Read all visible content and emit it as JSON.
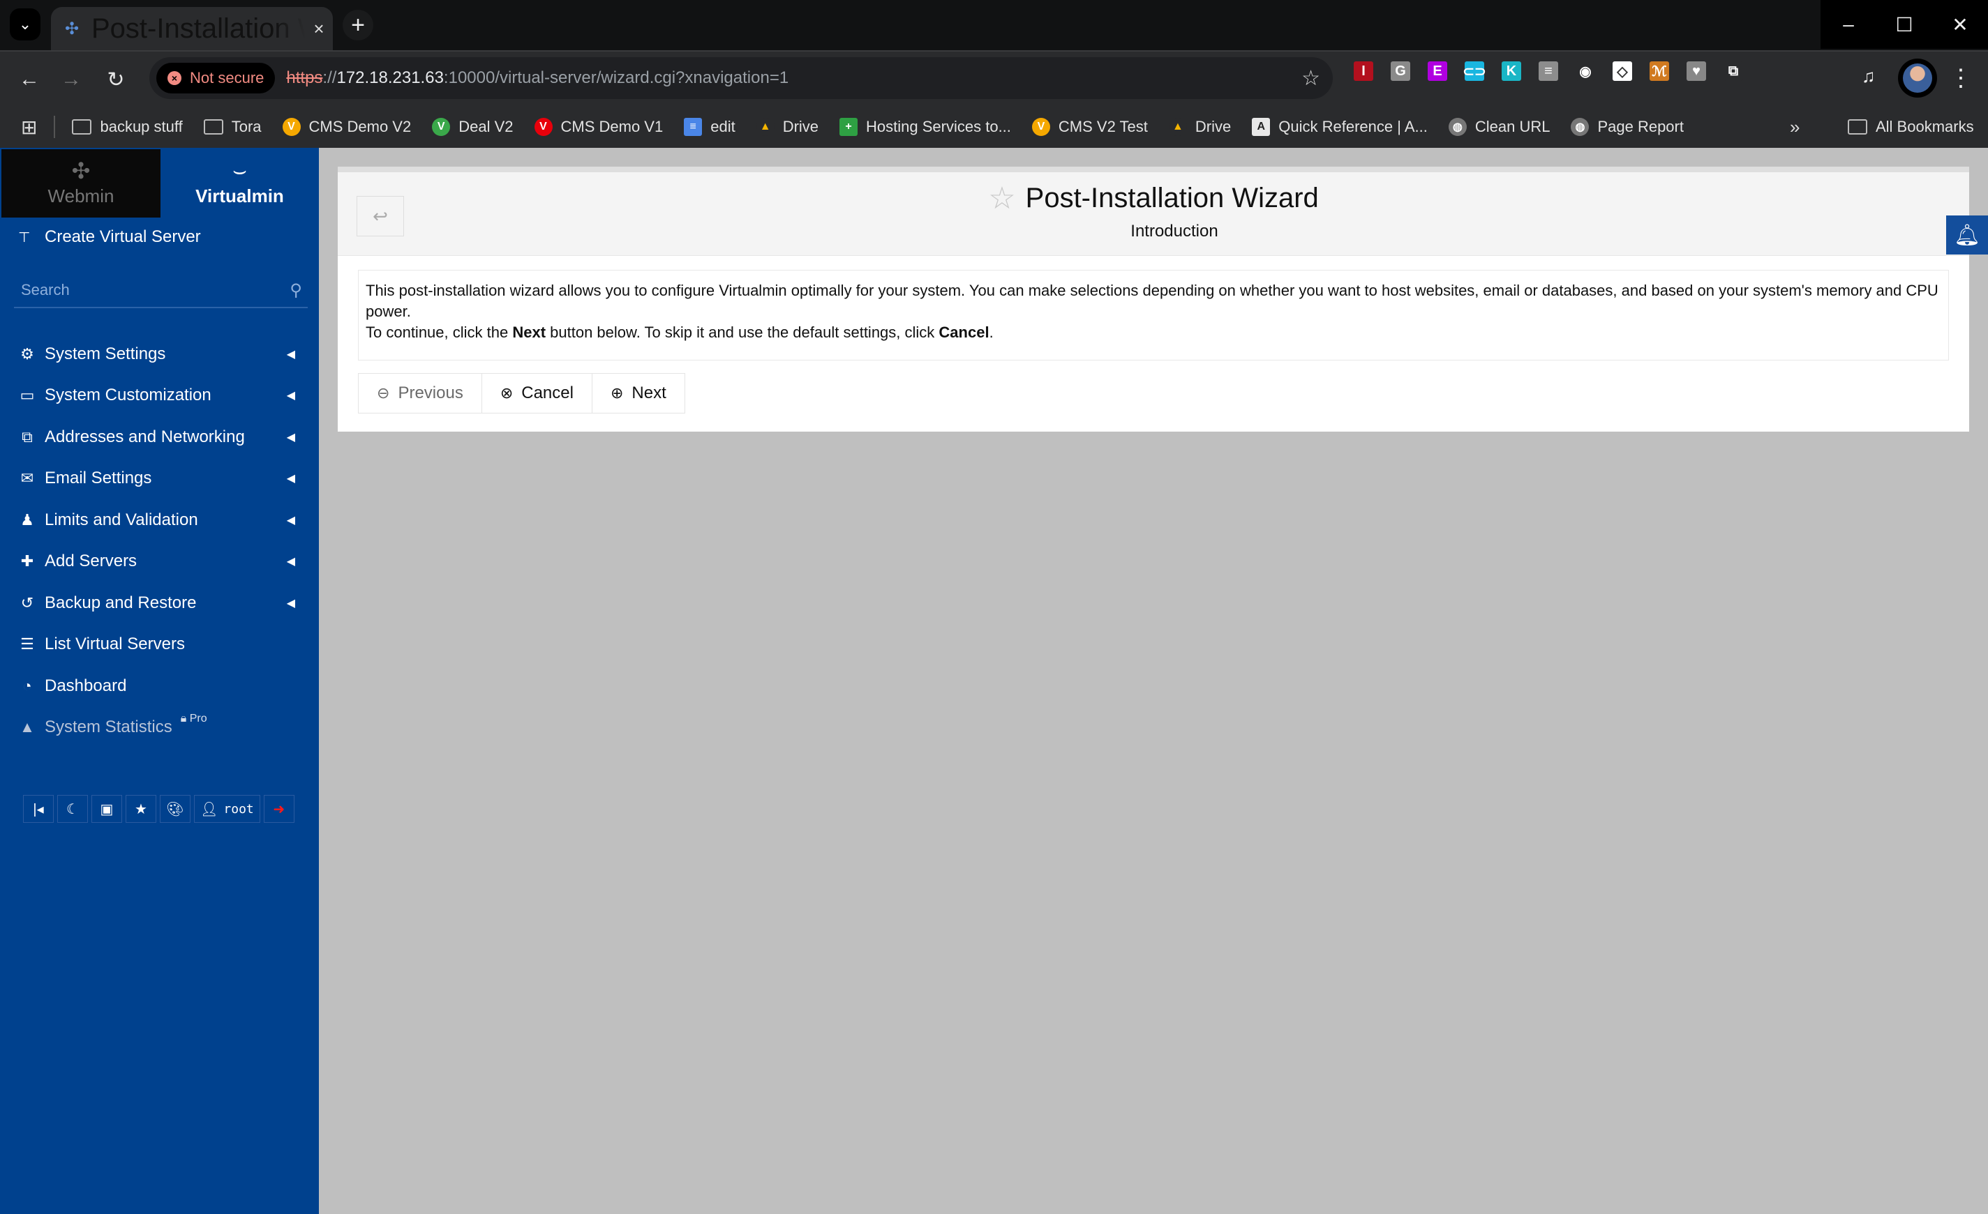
{
  "browser": {
    "tab_title": "Post-Installation Wizard — Webmin",
    "security_chip": "Not secure",
    "url": {
      "scheme": "https",
      "sep": "://",
      "host": "172.18.231.63",
      "rest": ":10000/virtual-server/wizard.cgi?xnavigation=1"
    },
    "extensions": [
      {
        "name": "ext-red-i",
        "glyph": "I",
        "color": "#b3101e"
      },
      {
        "name": "ext-grey-g",
        "glyph": "G",
        "color": "#8a8a8a"
      },
      {
        "name": "ext-purple-e",
        "glyph": "E",
        "color": "#b000e0"
      },
      {
        "name": "ext-link",
        "glyph": "⊂⊃",
        "color": "#19b6e0"
      },
      {
        "name": "ext-tk",
        "glyph": "K",
        "color": "#1ab6c6"
      },
      {
        "name": "ext-db",
        "glyph": "≡",
        "color": "#8d8d8d"
      },
      {
        "name": "ext-chrome",
        "glyph": "◉",
        "color": "#2a2b2d"
      },
      {
        "name": "ext-diamond",
        "glyph": "◇",
        "color": "#ffffff"
      },
      {
        "name": "ext-camel",
        "glyph": "ℳ",
        "color": "#d07a20"
      },
      {
        "name": "ext-heart",
        "glyph": "♥",
        "color": "#888888"
      },
      {
        "name": "ext-puzzle",
        "glyph": "⧉",
        "color": "#2a2b2d"
      }
    ],
    "bookmarks": [
      {
        "label": "backup stuff",
        "icon": "folder"
      },
      {
        "label": "Tora",
        "icon": "folder"
      },
      {
        "label": "CMS Demo V2",
        "icon": "V",
        "color": "#f5a800"
      },
      {
        "label": "Deal V2",
        "icon": "V",
        "color": "#3aa84a"
      },
      {
        "label": "CMS Demo V1",
        "icon": "V",
        "color": "#e8000b"
      },
      {
        "label": "edit",
        "icon": "≡",
        "color": "#4a86e8"
      },
      {
        "label": "Drive",
        "icon": "▲",
        "color": "#2a2b2d"
      },
      {
        "label": "Hosting Services to...",
        "icon": "+",
        "color": "#2ea043"
      },
      {
        "label": "CMS V2 Test",
        "icon": "V",
        "color": "#f5a800"
      },
      {
        "label": "Drive",
        "icon": "▲",
        "color": "#2a2b2d"
      },
      {
        "label": "Quick Reference | A...",
        "icon": "A",
        "color": "#e8e8e8"
      },
      {
        "label": "Clean URL",
        "icon": "globe",
        "color": "#777"
      },
      {
        "label": "Page Report",
        "icon": "globe",
        "color": "#777"
      }
    ],
    "all_bookmarks": "All Bookmarks"
  },
  "sidebar": {
    "switch": {
      "webmin": "Webmin",
      "virtualmin": "Virtualmin"
    },
    "create": "Create Virtual Server",
    "search_placeholder": "Search",
    "items": [
      {
        "label": "System Settings",
        "icon": "⚙",
        "expandable": true
      },
      {
        "label": "System Customization",
        "icon": "▭",
        "expandable": true
      },
      {
        "label": "Addresses and Networking",
        "icon": "⧉",
        "expandable": true
      },
      {
        "label": "Email Settings",
        "icon": "✉",
        "expandable": true
      },
      {
        "label": "Limits and Validation",
        "icon": "♟",
        "expandable": true
      },
      {
        "label": "Add Servers",
        "icon": "✚",
        "expandable": true
      },
      {
        "label": "Backup and Restore",
        "icon": "↺",
        "expandable": true
      },
      {
        "label": "List Virtual Servers",
        "icon": "☰",
        "expandable": false
      },
      {
        "label": "Dashboard",
        "icon": "◔",
        "expandable": false
      },
      {
        "label": "System Statistics",
        "icon": "▲",
        "expandable": false,
        "badge": "Pro",
        "disabled": true
      }
    ],
    "quickbar": {
      "user": "root"
    }
  },
  "page": {
    "title": "Post-Installation Wizard",
    "subtitle": "Introduction",
    "desc_line1": "This post-installation wizard allows you to configure Virtualmin optimally for your system. You can make selections depending on whether you want to host websites, email or databases, and based on your system's memory and CPU power.",
    "desc_line2_a": "To continue, click the ",
    "desc_line2_b": "Next",
    "desc_line2_c": " button below. To skip it and use the default settings, click ",
    "desc_line2_d": "Cancel",
    "desc_line2_e": ".",
    "buttons": {
      "previous": "Previous",
      "cancel": "Cancel",
      "next": "Next"
    }
  }
}
